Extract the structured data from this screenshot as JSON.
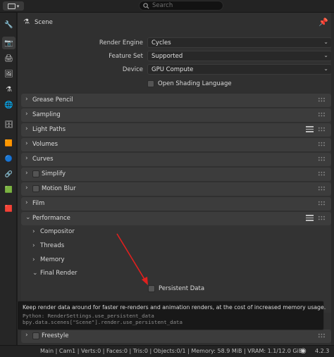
{
  "topbar": {
    "search_placeholder": "Search",
    "editor_icon": "properties-editor-icon"
  },
  "tabs": [
    {
      "icon": "tool-icon",
      "glyph": "🔧"
    },
    {
      "icon": "render-icon",
      "glyph": "📷"
    },
    {
      "icon": "output-icon",
      "glyph": "🖨"
    },
    {
      "icon": "view-layer-icon",
      "glyph": "🖼"
    },
    {
      "icon": "scene-icon",
      "glyph": "⚗"
    },
    {
      "icon": "world-icon",
      "glyph": "🌐"
    },
    {
      "icon": "collection-icon",
      "glyph": "🗄"
    },
    {
      "icon": "object-icon",
      "glyph": "🟧"
    },
    {
      "icon": "physics-icon",
      "glyph": "🔵"
    },
    {
      "icon": "constraints-icon",
      "glyph": "🔗"
    },
    {
      "icon": "data-icon",
      "glyph": "🟩"
    },
    {
      "icon": "texture-icon",
      "glyph": "🟥"
    }
  ],
  "header": {
    "title": "Scene"
  },
  "props": {
    "render_engine": {
      "label": "Render Engine",
      "value": "Cycles"
    },
    "feature_set": {
      "label": "Feature Set",
      "value": "Supported"
    },
    "device": {
      "label": "Device",
      "value": "GPU Compute"
    },
    "osl": {
      "label": "Open Shading Language"
    }
  },
  "panels": [
    {
      "label": "Grease Pencil"
    },
    {
      "label": "Sampling"
    },
    {
      "label": "Light Paths"
    },
    {
      "label": "Volumes"
    },
    {
      "label": "Curves"
    },
    {
      "label": "Simplify"
    },
    {
      "label": "Motion Blur"
    },
    {
      "label": "Film"
    },
    {
      "label": "Performance"
    }
  ],
  "performance_subpanels": [
    {
      "label": "Compositor"
    },
    {
      "label": "Threads"
    },
    {
      "label": "Memory"
    },
    {
      "label": "Final Render"
    }
  ],
  "persistent_data": {
    "label": "Persistent Data"
  },
  "tooltip": {
    "description": "Keep render data around for faster re-renders and animation renders, at the cost of increased memory usage.",
    "python": "Python: RenderSettings.use_persistent_data",
    "path": "bpy.data.scenes[\"Scene\"].render.use_persistent_data"
  },
  "freestyle": {
    "label": "Freestyle"
  },
  "status": {
    "text": "Main | Cam1 | Verts:0 | Faces:0 | Tris:0 | Objects:0/1 | Memory: 58.9 MiB | VRAM: 1.1/12.0 GiB",
    "version": "4.2.3"
  },
  "colors": {
    "accent_arrow": "#e0201e",
    "panel_bg": "#3c3c3c",
    "main_bg": "#303030"
  }
}
